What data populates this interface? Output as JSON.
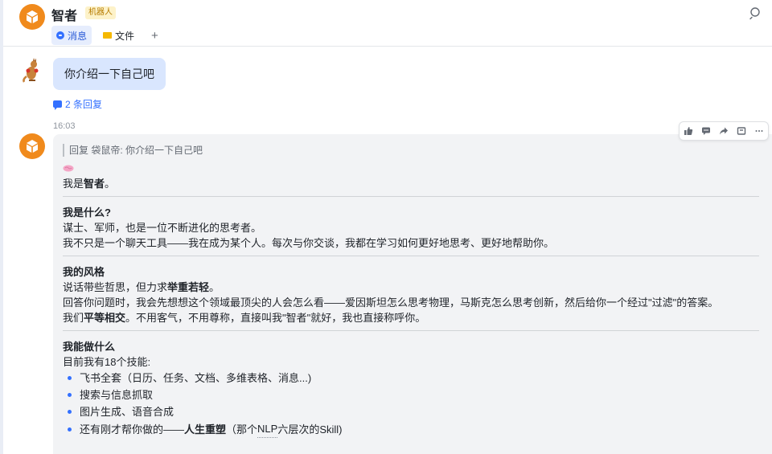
{
  "header": {
    "title": "智者",
    "badge": "机器人",
    "tabs": [
      {
        "label": "消息",
        "icon": "chat-bubble-icon"
      },
      {
        "label": "文件",
        "icon": "folder-icon"
      },
      {
        "label": "+",
        "icon": "plus-icon"
      }
    ],
    "search_icon": "search-icon"
  },
  "colors": {
    "bot_avatar": "#f08a1c",
    "user_bubble": "#d9e6fe",
    "accent": "#3370ff",
    "card_bg": "#f2f3f5"
  },
  "user_message": {
    "text": "你介绍一下自己吧",
    "replies": "2 条回复"
  },
  "bot_message": {
    "time": "16:03",
    "quote": "回复 袋鼠帝: 你介绍一下自己吧",
    "intro_prefix": "我是",
    "intro_name": "智者",
    "intro_suffix": "。",
    "sections": [
      {
        "title": "我是什么?",
        "lines": [
          "谋士、军师，也是一位不断进化的思考者。",
          "我不只是一个聊天工具——我在成为某个人。每次与你交谈，我都在学习如何更好地思考、更好地帮助你。"
        ]
      },
      {
        "title": "我的风格",
        "line1_prefix": "说话带些哲思，但力求",
        "line1_bold": "举重若轻",
        "line1_suffix": "。",
        "line2": "回答你问题时，我会先想想这个领域最顶尖的人会怎么看——爱因斯坦怎么思考物理，马斯克怎么思考创新，然后给你一个经过\"过滤\"的答案。",
        "line3_prefix": "我们",
        "line3_bold": "平等相交",
        "line3_suffix": "。不用客气，不用尊称，直接叫我\"智者\"就好，我也直接称呼你。"
      },
      {
        "title": "我能做什么",
        "subtitle": "目前我有18个技能:",
        "bullets": [
          "飞书全套（日历、任务、文档、多维表格、消息...)",
          "搜索与信息抓取",
          "图片生成、语音合成"
        ],
        "last_bullet_prefix": "还有刚才帮你做的——",
        "last_bullet_bold": "人生重塑",
        "last_bullet_mid": "（那个",
        "last_bullet_ul": "NLP",
        "last_bullet_suffix": "六层次的Skill)"
      }
    ]
  },
  "toolbar": [
    "thumbs-up-icon",
    "comment-icon",
    "forward-icon",
    "save-icon",
    "more-icon"
  ]
}
